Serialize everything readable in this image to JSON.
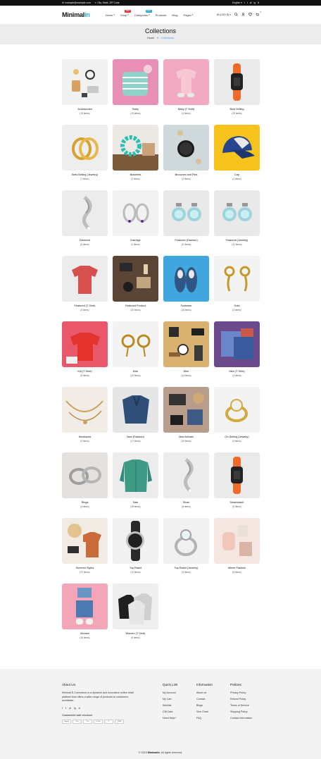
{
  "topbar": {
    "email": "example@example.com",
    "address": "City, State, ZIP Code",
    "language": "English",
    "social": [
      "f",
      "t",
      "yt",
      "ig",
      "tt"
    ]
  },
  "header": {
    "logo_main": "Minimal",
    "logo_accent": "in",
    "nav": [
      {
        "label": "Home",
        "badge": "",
        "badge_color": ""
      },
      {
        "label": "Shop",
        "badge": "NEW",
        "badge_color": "#e03535"
      },
      {
        "label": "Categories",
        "badge": "SALE",
        "badge_color": "#2aa7e0"
      },
      {
        "label": "Products",
        "badge": "",
        "badge_color": ""
      },
      {
        "label": "Blog",
        "badge": "",
        "badge_color": ""
      },
      {
        "label": "Pages",
        "badge": "",
        "badge_color": ""
      }
    ],
    "currency": "IN (USD $)",
    "cart_count": "0"
  },
  "page": {
    "title": "Collections",
    "breadcrumb_home": "Home",
    "breadcrumb_sep": "»",
    "breadcrumb_current": "Collections"
  },
  "collections": [
    {
      "title": "Accessories",
      "count": "(19 items)",
      "bg": "#f1f1f1",
      "art": "accessories"
    },
    {
      "title": "Baby",
      "count": "(10 items)",
      "bg": "#e78fb5",
      "art": "baby"
    },
    {
      "title": "Baby (T Shirt)",
      "count": "(4 items)",
      "bg": "#f2a9c2",
      "art": "babytee"
    },
    {
      "title": "Best Selling",
      "count": "(20 items)",
      "bg": "#eaeaea",
      "art": "watch"
    },
    {
      "title": "Best-Selling (Jewelry)",
      "count": "(7 items)",
      "bg": "#eeeeee",
      "art": "rings"
    },
    {
      "title": "Bracelets",
      "count": "(1 items)",
      "bg": "#ece8e3",
      "art": "bracelet"
    },
    {
      "title": "Brooches and Pins",
      "count": "(2 items)",
      "bg": "#cfd8db",
      "art": "pins"
    },
    {
      "title": "Cap",
      "count": "(2 items)",
      "bg": "#f6c21c",
      "art": "cap"
    },
    {
      "title": "Diamond",
      "count": "(6 items)",
      "bg": "#ececec",
      "art": "swirl"
    },
    {
      "title": "Earrings",
      "count": "(1 items)",
      "bg": "#f2f2f2",
      "art": "hoops"
    },
    {
      "title": "Featured (Fashion)",
      "count": "(11 items)",
      "bg": "#e9e9e9",
      "art": "studs"
    },
    {
      "title": "Featured (Jewelry)",
      "count": "(12 items)",
      "bg": "#e9e9e9",
      "art": "studs"
    },
    {
      "title": "Featured (T Shirt)",
      "count": "(9 items)",
      "bg": "#ececec",
      "art": "redtee"
    },
    {
      "title": "Featured Product",
      "count": "(20 items)",
      "bg": "#5a4436",
      "art": "flatlay"
    },
    {
      "title": "Footwear",
      "count": "(16 items)",
      "bg": "#3fa7de",
      "art": "shoes"
    },
    {
      "title": "Gold",
      "count": "(3 items)",
      "bg": "#f3f3f3",
      "art": "golddrops"
    },
    {
      "title": "Kid (T Shirt)",
      "count": "(5 items)",
      "bg": "#e9576b",
      "art": "kidtee"
    },
    {
      "title": "Kids",
      "count": "(10 items)",
      "bg": "#f3f3f3",
      "art": "goldhoops"
    },
    {
      "title": "Men",
      "count": "(14 items)",
      "bg": "#d9b171",
      "art": "menflat"
    },
    {
      "title": "Men (T Shirt)",
      "count": "(3 items)",
      "bg": "#6a4a8c",
      "art": "folded"
    },
    {
      "title": "Necklaces",
      "count": "(2 items)",
      "bg": "#f1ece5",
      "art": "necklace"
    },
    {
      "title": "New (Fashion)",
      "count": "(17 items)",
      "bg": "#e6e6e6",
      "art": "denim"
    },
    {
      "title": "New Arrivals",
      "count": "(20 items)",
      "bg": "#b89d8c",
      "art": "arrivals"
    },
    {
      "title": "On-Selling (Jewelry)",
      "count": "(4 items)",
      "bg": "#f3f3f3",
      "art": "goldring"
    },
    {
      "title": "Rings",
      "count": "(4 items)",
      "bg": "#e4e1df",
      "art": "silverrings"
    },
    {
      "title": "Sale",
      "count": "(29 items)",
      "bg": "#ececec",
      "art": "shirt"
    },
    {
      "title": "Silver",
      "count": "(8 items)",
      "bg": "#ececec",
      "art": "swirl"
    },
    {
      "title": "Smartwatch",
      "count": "(5 items)",
      "bg": "#eaeaea",
      "art": "watch"
    },
    {
      "title": "Summer Styles",
      "count": "(27 items)",
      "bg": "#f1ebe3",
      "art": "summer"
    },
    {
      "title": "Top Rated",
      "count": "(12 items)",
      "bg": "#f1f1f1",
      "art": "blackwatch"
    },
    {
      "title": "Top Rated (Jewelry)",
      "count": "(5 items)",
      "bg": "#f1f1f1",
      "art": "silverring"
    },
    {
      "title": "Winter Fashion",
      "count": "(8 items)",
      "bg": "#f5e6e1",
      "art": "winter"
    },
    {
      "title": "Women",
      "count": "(15 items)",
      "bg": "#f2a6b7",
      "art": "women"
    },
    {
      "title": "Women (T Shirt)",
      "count": "(5 items)",
      "bg": "#efefef",
      "art": "hangers"
    }
  ],
  "footer": {
    "about_title": "About Us.",
    "about_text": "Minimal E-Commerce is a dynamic and innovative online retail platform that offers a wide range of products to customers worldwide.",
    "social": [
      "f",
      "t",
      "yt",
      "ig",
      "tt"
    ],
    "guarantee": "Guaranteed safe checkout",
    "payments": [
      "shopify",
      "Pay",
      "Pay",
      "G Pay",
      "P",
      "VISA"
    ],
    "quick_title": "Quick Link",
    "quick_links": [
      "My Account",
      "My Cart",
      "Wishlist",
      "Gift Card",
      "Need Help?"
    ],
    "info_title": "Information",
    "info_links": [
      "About us",
      "Contact",
      "Blogs",
      "Size Chart",
      "FAQ"
    ],
    "policy_title": "Policies",
    "policy_links": [
      "Privacy Policy",
      "Refund Policy",
      "Terms of Service",
      "Shipping Policy",
      "Contact Information"
    ],
    "copyright_prefix": "© 2023",
    "copyright_brand": "Minimalin",
    "copyright_suffix": ". All rights reserved."
  }
}
